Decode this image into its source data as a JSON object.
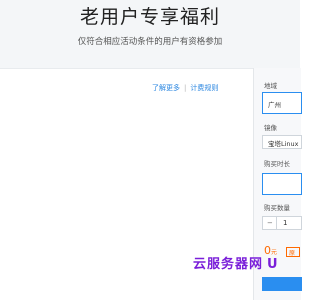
{
  "hero": {
    "title": "老用户专享福利",
    "subtitle": "仅符合相应活动条件的用户有资格参加"
  },
  "links": {
    "learn_more": "了解更多",
    "billing_rules": "计费规则"
  },
  "order_panel": {
    "region_label": "地域",
    "region_value": "广州",
    "image_label": "镜像",
    "image_value": "宝塔Linux",
    "duration_label": "购买时长",
    "quantity_label": "购买数量",
    "quantity_minus": "−",
    "quantity_value": "1",
    "price": "0",
    "price_unit": "元",
    "price_tag": "原"
  },
  "watermark": {
    "cn": "云服务器网",
    "en": "U"
  },
  "colors": {
    "accent": "#2a8ef0",
    "price": "#ff6a00",
    "watermark": "#7a1fd9"
  }
}
